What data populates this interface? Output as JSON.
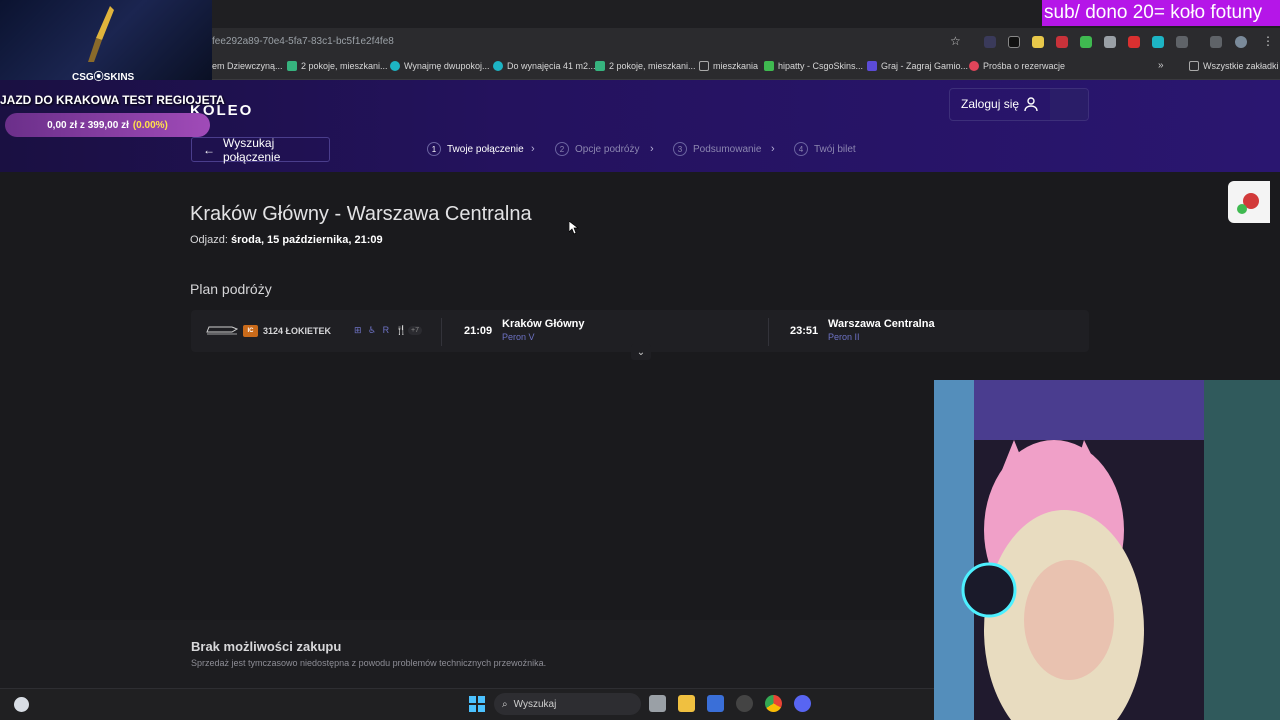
{
  "browser": {
    "url": "fee292a89-70e4-5fa7-83c1-bc5f1e2f4fe8",
    "bookmarks": [
      {
        "label": "em Dziewczyną...",
        "color": "#5a5a5a"
      },
      {
        "label": "2 pokoje, mieszkani...",
        "color": "#36b37e"
      },
      {
        "label": "Wynajmę dwupokoj...",
        "color": "#1db4c4"
      },
      {
        "label": "Do wynajęcia 41 m2...",
        "color": "#1db4c4"
      },
      {
        "label": "2 pokoje, mieszkani...",
        "color": "#36b37e"
      },
      {
        "label": "mieszkania",
        "color": "#888888"
      },
      {
        "label": "hipatty - CsgoSkins...",
        "color": "#3fb950"
      },
      {
        "label": "Graj - Zagraj Gamio...",
        "color": "#5b4bd6"
      },
      {
        "label": "Prośba o rezerwacje",
        "color": "#e0455a"
      }
    ],
    "all_bookmarks": "Wszystkie zakładki"
  },
  "koleo": {
    "logo": "KOLEO",
    "login": "Zaloguj się",
    "back": "Wyszukaj połączenie",
    "steps": [
      {
        "num": "1",
        "label": "Twoje połączenie"
      },
      {
        "num": "2",
        "label": "Opcje podróży"
      },
      {
        "num": "3",
        "label": "Podsumowanie"
      },
      {
        "num": "4",
        "label": "Twój bilet"
      }
    ]
  },
  "route": {
    "title": "Kraków Główny - Warszawa Centralna",
    "depart_label": "Odjazd:",
    "depart_value": "środa, 15 października, 21:09"
  },
  "plan": {
    "title": "Plan podróży",
    "carrier_badge": "IC",
    "train_name": "3124 ŁOKIETEK",
    "amenities": "⊞ ♿ R 🍴✱",
    "amenities_more": "+7",
    "dep_time": "21:09",
    "dep_station": "Kraków Główny",
    "dep_platform": "Peron V",
    "arr_time": "23:51",
    "arr_station": "Warszawa Centralna",
    "arr_platform": "Peron II"
  },
  "notice": {
    "title": "Brak możliwości zakupu",
    "text": "Sprzedaż jest tymczasowo niedostępna z powodu problemów technicznych przewoźnika."
  },
  "taskbar": {
    "search": "Wyszukaj"
  },
  "overlay": {
    "skins_label": "CSG⦿SKINS",
    "goal_title": "JAZD DO KRAKOWA TEST REGIOJETA",
    "goal_amount": "0,00 zł z 399,00 zł",
    "goal_pct": "(0.00%)",
    "sub_banner": "sub/ dono 20= koło fotuny"
  }
}
